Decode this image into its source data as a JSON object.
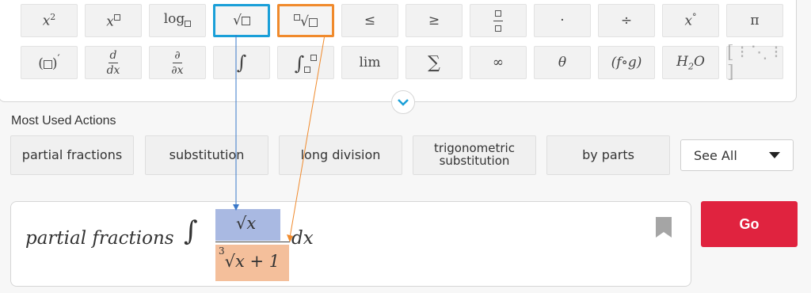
{
  "keypad": {
    "row1": [
      "x2",
      "x□",
      "log□",
      "√□",
      "□√□",
      "≤",
      "≥",
      "□/□",
      "·",
      "÷",
      "x°",
      "π"
    ],
    "row2": [
      "(□)′",
      "d/dx",
      "∂/∂x",
      "∫",
      "∫□□",
      "lim",
      "∑",
      "∞",
      "θ",
      "(f∘g)",
      "H2O",
      "matrix"
    ],
    "highlight_colors": {
      "sqrt": "#1a9fd8",
      "nth_root": "#f08a2c"
    }
  },
  "actions": {
    "title": "Most Used Actions",
    "items": [
      "partial fractions",
      "substitution",
      "long division",
      "trigonometric substitution",
      "by parts"
    ],
    "see_all": "See All"
  },
  "input": {
    "prefix": "partial fractions",
    "numerator": "√x",
    "denominator_index": "3",
    "denominator": "√x + 1",
    "differential": "dx",
    "numerator_highlight": "#a9b9e2",
    "denominator_highlight": "#f4bf9b"
  },
  "go_button": {
    "label": "Go",
    "color": "#e0233f"
  }
}
